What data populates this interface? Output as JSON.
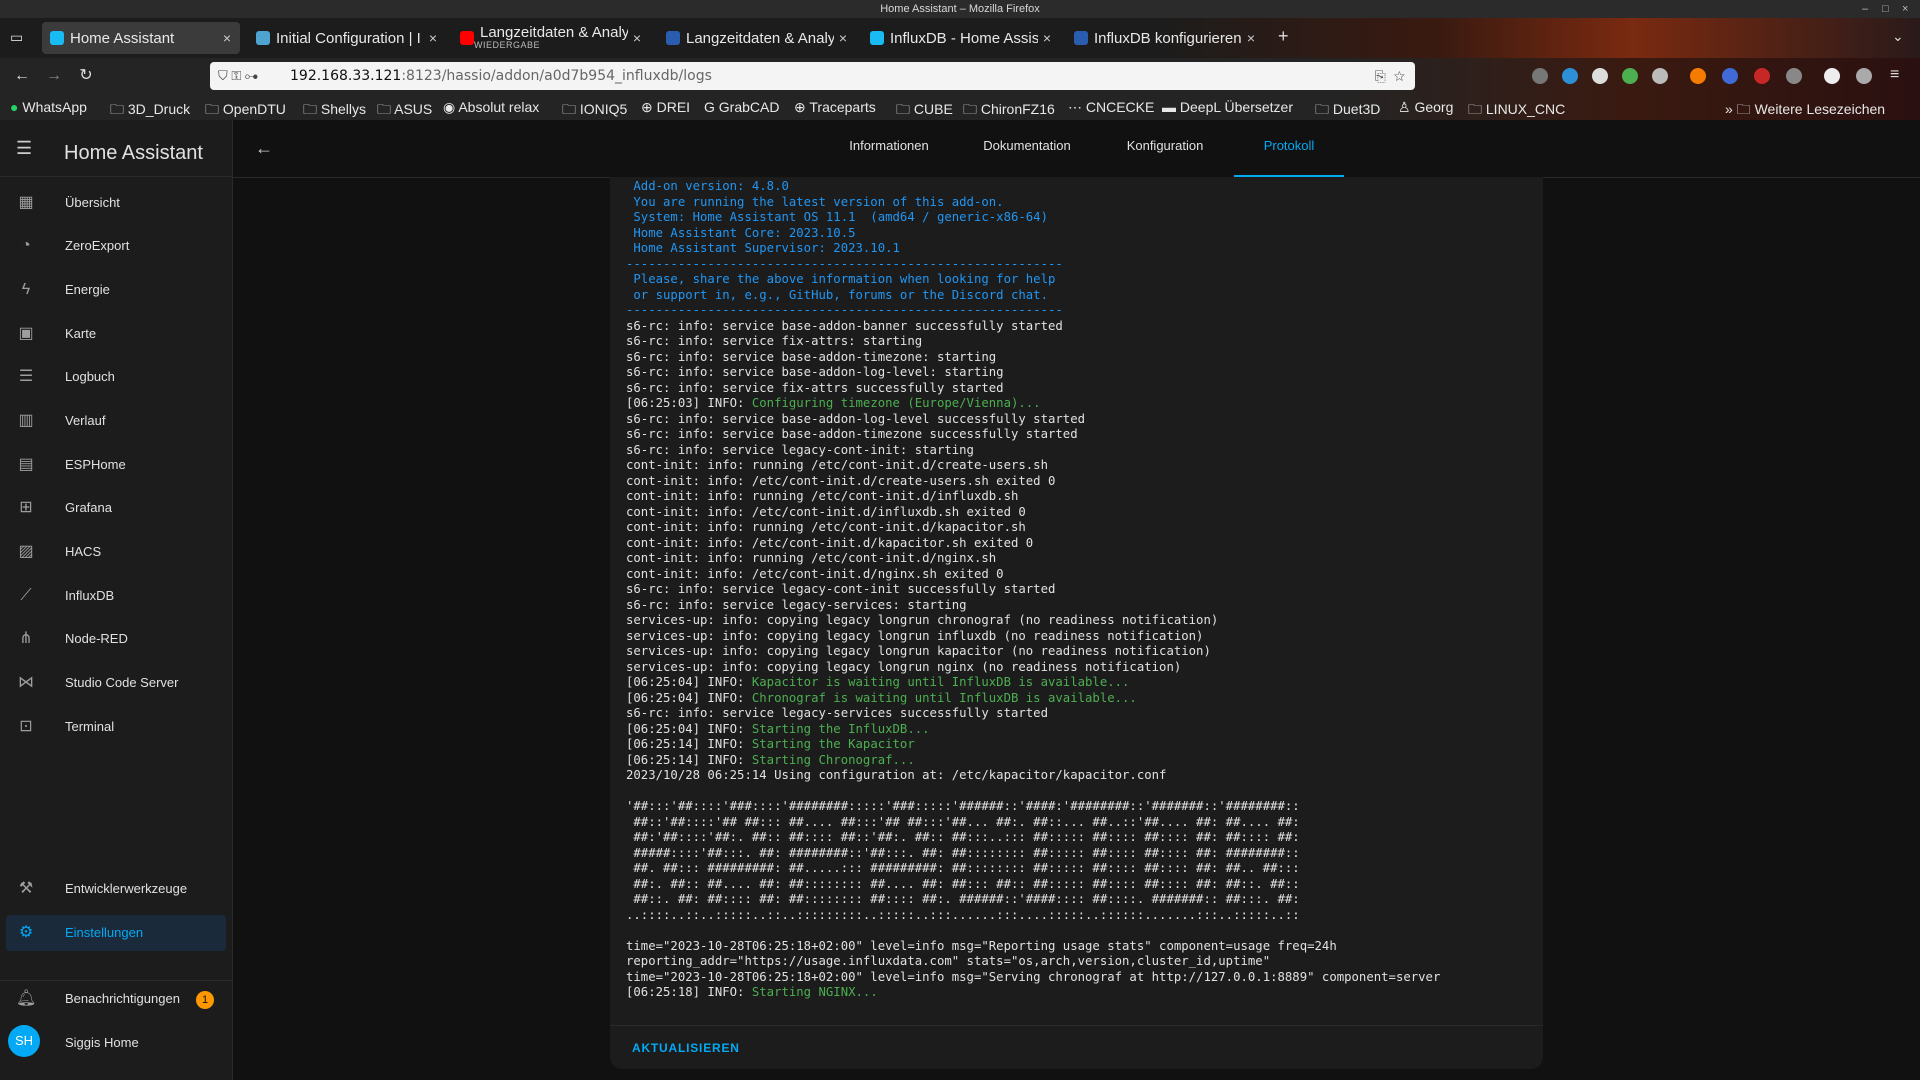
{
  "window": {
    "title": "Home Assistant – Mozilla Firefox"
  },
  "tabs": [
    {
      "title": "Home Assistant",
      "active": true,
      "icon_color": "#18bcf2"
    },
    {
      "title": "Initial Configuration | I",
      "active": false,
      "icon_color": "#4fa3d1"
    },
    {
      "title": "Langzeitdaten & Analy",
      "subtitle": "WIEDERGABE",
      "active": false,
      "icon_color": "#ff0000"
    },
    {
      "title": "Langzeitdaten & Analy",
      "active": false,
      "icon_color": "#2a5db0"
    },
    {
      "title": "InfluxDB - Home Assis",
      "active": false,
      "icon_color": "#18bcf2"
    },
    {
      "title": "InfluxDB konfigurieren",
      "active": false,
      "icon_color": "#2a5db0"
    }
  ],
  "url": {
    "host": "192.168.33.121",
    "path": ":8123/hassio/addon/a0d7b954_influxdb/logs"
  },
  "bookmarks": [
    "WhatsApp",
    "3D_Druck",
    "OpenDTU",
    "Shellys",
    "ASUS",
    "Absolut relax",
    "IONIQ5",
    "DREI",
    "GrabCAD",
    "Traceparts",
    "CUBE",
    "ChironFZ16",
    "CNCECKE",
    "DeepL Übersetzer",
    "Duet3D",
    "Georg",
    "LINUX_CNC",
    "Weitere Lesezeichen"
  ],
  "sidebar": {
    "title": "Home Assistant",
    "items": [
      {
        "label": "Übersicht",
        "icon": "dashboard-icon"
      },
      {
        "label": "ZeroExport",
        "icon": "gauge-icon"
      },
      {
        "label": "Energie",
        "icon": "lightning-icon"
      },
      {
        "label": "Karte",
        "icon": "map-icon"
      },
      {
        "label": "Logbuch",
        "icon": "list-icon"
      },
      {
        "label": "Verlauf",
        "icon": "chart-icon"
      },
      {
        "label": "ESPHome",
        "icon": "chip-icon"
      },
      {
        "label": "Grafana",
        "icon": "grafana-icon"
      },
      {
        "label": "HACS",
        "icon": "hacs-icon"
      },
      {
        "label": "InfluxDB",
        "icon": "chart-line-icon"
      },
      {
        "label": "Node-RED",
        "icon": "sitemap-icon"
      },
      {
        "label": "Studio Code Server",
        "icon": "vscode-icon"
      },
      {
        "label": "Terminal",
        "icon": "terminal-icon"
      }
    ],
    "developer_tools": "Entwicklerwerkzeuge",
    "settings": "Einstellungen",
    "notifications": "Benachrichtigungen",
    "notification_count": "1",
    "user_initials": "SH",
    "user_name": "Siggis Home",
    "accent_color": "#03a9f4"
  },
  "main_tabs": [
    {
      "label": "Informationen",
      "active": false
    },
    {
      "label": "Dokumentation",
      "active": false
    },
    {
      "label": "Konfiguration",
      "active": false
    },
    {
      "label": "Protokoll",
      "active": true
    }
  ],
  "log_lines": [
    {
      "t": " Add-on version: 4.8.0",
      "c": "blue"
    },
    {
      "t": " You are running the latest version of this add-on.",
      "c": "blue"
    },
    {
      "t": " System: Home Assistant OS 11.1  (amd64 / generic-x86-64)",
      "c": "blue"
    },
    {
      "t": " Home Assistant Core: 2023.10.5",
      "c": "blue"
    },
    {
      "t": " Home Assistant Supervisor: 2023.10.1",
      "c": "blue"
    },
    {
      "t": "-----------------------------------------------------------",
      "c": "blue"
    },
    {
      "t": " Please, share the above information when looking for help",
      "c": "blue"
    },
    {
      "t": " or support in, e.g., GitHub, forums or the Discord chat.",
      "c": "blue"
    },
    {
      "t": "-----------------------------------------------------------",
      "c": "blue"
    },
    {
      "t": "s6-rc: info: service base-addon-banner successfully started"
    },
    {
      "t": "s6-rc: info: service fix-attrs: starting"
    },
    {
      "t": "s6-rc: info: service base-addon-timezone: starting"
    },
    {
      "t": "s6-rc: info: service base-addon-log-level: starting"
    },
    {
      "t": "s6-rc: info: service fix-attrs successfully started"
    },
    {
      "t": "[06:25:03] INFO: ",
      "g": "Configuring timezone (Europe/Vienna)..."
    },
    {
      "t": "s6-rc: info: service base-addon-log-level successfully started"
    },
    {
      "t": "s6-rc: info: service base-addon-timezone successfully started"
    },
    {
      "t": "s6-rc: info: service legacy-cont-init: starting"
    },
    {
      "t": "cont-init: info: running /etc/cont-init.d/create-users.sh"
    },
    {
      "t": "cont-init: info: /etc/cont-init.d/create-users.sh exited 0"
    },
    {
      "t": "cont-init: info: running /etc/cont-init.d/influxdb.sh"
    },
    {
      "t": "cont-init: info: /etc/cont-init.d/influxdb.sh exited 0"
    },
    {
      "t": "cont-init: info: running /etc/cont-init.d/kapacitor.sh"
    },
    {
      "t": "cont-init: info: /etc/cont-init.d/kapacitor.sh exited 0"
    },
    {
      "t": "cont-init: info: running /etc/cont-init.d/nginx.sh"
    },
    {
      "t": "cont-init: info: /etc/cont-init.d/nginx.sh exited 0"
    },
    {
      "t": "s6-rc: info: service legacy-cont-init successfully started"
    },
    {
      "t": "s6-rc: info: service legacy-services: starting"
    },
    {
      "t": "services-up: info: copying legacy longrun chronograf (no readiness notification)"
    },
    {
      "t": "services-up: info: copying legacy longrun influxdb (no readiness notification)"
    },
    {
      "t": "services-up: info: copying legacy longrun kapacitor (no readiness notification)"
    },
    {
      "t": "services-up: info: copying legacy longrun nginx (no readiness notification)"
    },
    {
      "t": "[06:25:04] INFO: ",
      "g": "Kapacitor is waiting until InfluxDB is available..."
    },
    {
      "t": "[06:25:04] INFO: ",
      "g": "Chronograf is waiting until InfluxDB is available..."
    },
    {
      "t": "s6-rc: info: service legacy-services successfully started"
    },
    {
      "t": "[06:25:04] INFO: ",
      "g": "Starting the InfluxDB..."
    },
    {
      "t": "[06:25:14] INFO: ",
      "g": "Starting the Kapacitor"
    },
    {
      "t": "[06:25:14] INFO: ",
      "g": "Starting Chronograf..."
    },
    {
      "t": "2023/10/28 06:25:14 Using configuration at: /etc/kapacitor/kapacitor.conf"
    },
    {
      "t": ""
    },
    {
      "t": "'##:::'##::::'###::::'########:::::'###:::::'######::'####:'########::'#######::'########::"
    },
    {
      "t": " ##::'##::::'## ##::: ##.... ##:::'## ##:::'##... ##:. ##::... ##..::'##.... ##: ##.... ##:"
    },
    {
      "t": " ##:'##::::'##:. ##:: ##:::: ##::'##:. ##:: ##:::..::: ##::::: ##:::: ##:::: ##: ##:::: ##:"
    },
    {
      "t": " #####::::'##:::. ##: ########::'##:::. ##: ##:::::::: ##::::: ##:::: ##:::: ##: ########::"
    },
    {
      "t": " ##. ##::: #########: ##.....::: #########: ##:::::::: ##::::: ##:::: ##:::: ##: ##.. ##:::"
    },
    {
      "t": " ##:. ##:: ##.... ##: ##:::::::: ##.... ##: ##::: ##:: ##::::: ##:::: ##:::: ##: ##::. ##::"
    },
    {
      "t": " ##::. ##: ##:::: ##: ##:::::::: ##:::: ##:. ######::'####:::: ##::::. #######:: ##:::. ##:"
    },
    {
      "t": "..::::..::..:::::..::..:::::::::..:::::..:::......:::....:::::..::::::.......:::..:::::..::"
    },
    {
      "t": ""
    },
    {
      "t": "time=\"2023-10-28T06:25:18+02:00\" level=info msg=\"Reporting usage stats\" component=usage freq=24h"
    },
    {
      "t": "reporting_addr=\"https://usage.influxdata.com\" stats=\"os,arch,version,cluster_id,uptime\""
    },
    {
      "t": "time=\"2023-10-28T06:25:18+02:00\" level=info msg=\"Serving chronograf at http://127.0.0.1:8889\" component=server"
    },
    {
      "t": "[06:25:18] INFO: ",
      "g": "Starting NGINX..."
    }
  ],
  "refresh_label": "AKTUALISIEREN"
}
